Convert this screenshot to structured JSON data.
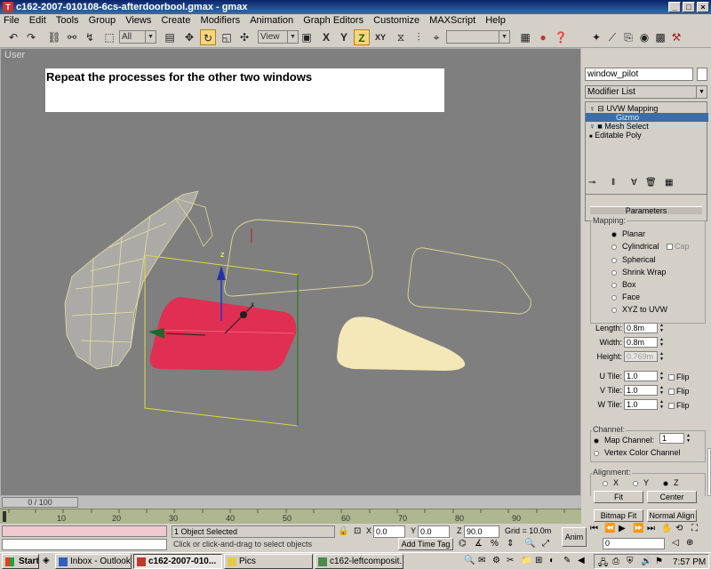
{
  "window": {
    "title": "c162-2007-010108-6cs-afterdoorbool.gmax - gmax",
    "app_icon": "gmax-logo-icon",
    "buttons": {
      "minimize": "_",
      "maximize": "□",
      "close": "×"
    }
  },
  "menu": [
    "File",
    "Edit",
    "Tools",
    "Group",
    "Views",
    "Create",
    "Modifiers",
    "Animation",
    "Graph Editors",
    "Customize",
    "MAXScript",
    "Help"
  ],
  "toolbar": {
    "selection_filter": "All",
    "reference_coord": "View",
    "axis_constraints": [
      "X",
      "Y",
      "Z",
      "XY"
    ],
    "named_selection": ""
  },
  "viewport": {
    "label": "User",
    "caption": "Repeat the processes for the other two windows"
  },
  "panel": {
    "object_name": "window_pilot",
    "modifier_list": "Modifier List",
    "stack": [
      {
        "label": "UVW Mapping",
        "level": 0,
        "selected": false,
        "expander": "⊟"
      },
      {
        "label": "Gizmo",
        "level": 1,
        "selected": true,
        "expander": ""
      },
      {
        "label": "Mesh Select",
        "level": 0,
        "selected": false,
        "expander": "■"
      },
      {
        "label": "Editable Poly",
        "level": 0,
        "selected": false,
        "expander": ""
      }
    ],
    "parameters_title": "Parameters",
    "mapping_group": "Mapping:",
    "mapping_options": [
      "Planar",
      "Cylindrical",
      "Spherical",
      "Shrink Wrap",
      "Box",
      "Face",
      "XYZ to UVW"
    ],
    "mapping_selected": "Planar",
    "cap_label": "Cap",
    "length_label": "Length:",
    "length_value": "0.8m",
    "width_label": "Width:",
    "width_value": "0.8m",
    "height_label": "Height:",
    "height_value": "0.769m",
    "utile_label": "U Tile:",
    "utile_value": "1.0",
    "vtile_label": "V Tile:",
    "vtile_value": "1.0",
    "wtile_label": "W Tile:",
    "wtile_value": "1.0",
    "flip_label": "Flip",
    "channel_group": "Channel:",
    "map_channel_label": "Map Channel:",
    "map_channel_value": "1",
    "vertex_color_label": "Vertex Color Channel",
    "alignment_group": "Alignment:",
    "align_axes": [
      "X",
      "Y",
      "Z"
    ],
    "align_selected": "Z",
    "fit_label": "Fit",
    "center_label": "Center",
    "bitmap_fit_label": "Bitmap Fit",
    "normal_align_label": "Normal Align"
  },
  "timeline": {
    "slider": "0 / 100",
    "ticks": [
      "10",
      "20",
      "30",
      "40",
      "50",
      "60",
      "70",
      "80",
      "90"
    ]
  },
  "status": {
    "selection": "1 Object Selected",
    "prompt": "Click or click-and-drag to select objects",
    "x_label": "X",
    "x_value": "0.0",
    "y_label": "Y",
    "y_value": "0.0",
    "z_label": "Z",
    "z_value": "90.0",
    "grid": "Grid = 10.0m",
    "add_time_tag": "Add Time Tag",
    "anim": "Anim",
    "frame": "0"
  },
  "taskbar": {
    "start": "Start",
    "tasks": [
      "Inbox - Outlook E...",
      "c162-2007-010...",
      "Pics",
      "c162-leftcomposit..."
    ],
    "active_task": 1,
    "clock": "7:57 PM"
  }
}
